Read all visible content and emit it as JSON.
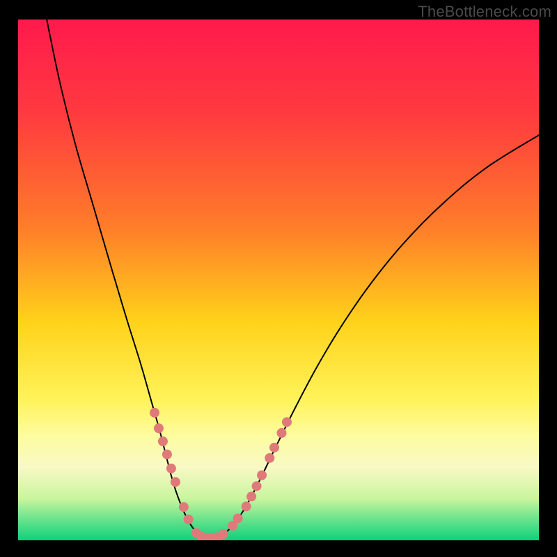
{
  "watermark": "TheBottleneck.com",
  "chart_data": {
    "type": "line",
    "title": "",
    "xlabel": "",
    "ylabel": "",
    "xlim": [
      0,
      100
    ],
    "ylim": [
      0,
      100
    ],
    "background": {
      "type": "vertical-gradient",
      "stops": [
        {
          "offset": 0.0,
          "color": "#ff1a4c"
        },
        {
          "offset": 0.18,
          "color": "#ff3a3f"
        },
        {
          "offset": 0.4,
          "color": "#ff7d2a"
        },
        {
          "offset": 0.58,
          "color": "#ffd21a"
        },
        {
          "offset": 0.73,
          "color": "#fff35a"
        },
        {
          "offset": 0.8,
          "color": "#fdfca0"
        },
        {
          "offset": 0.86,
          "color": "#f8f9c4"
        },
        {
          "offset": 0.92,
          "color": "#c9f59e"
        },
        {
          "offset": 0.965,
          "color": "#5de08a"
        },
        {
          "offset": 1.0,
          "color": "#10d07a"
        }
      ]
    },
    "series": [
      {
        "name": "left-curve",
        "stroke": "#000000",
        "points": [
          {
            "x": 5.5,
            "y": 100
          },
          {
            "x": 8.0,
            "y": 88
          },
          {
            "x": 11.0,
            "y": 76
          },
          {
            "x": 14.5,
            "y": 64
          },
          {
            "x": 18.0,
            "y": 52
          },
          {
            "x": 21.0,
            "y": 42
          },
          {
            "x": 23.5,
            "y": 34
          },
          {
            "x": 25.5,
            "y": 27
          },
          {
            "x": 27.2,
            "y": 21
          },
          {
            "x": 28.6,
            "y": 15.5
          },
          {
            "x": 29.8,
            "y": 11
          },
          {
            "x": 31.0,
            "y": 7.5
          },
          {
            "x": 32.2,
            "y": 4.7
          },
          {
            "x": 33.4,
            "y": 2.6
          },
          {
            "x": 34.7,
            "y": 1.2
          },
          {
            "x": 36.0,
            "y": 0.6
          },
          {
            "x": 37.3,
            "y": 0.5
          }
        ]
      },
      {
        "name": "right-curve",
        "stroke": "#000000",
        "points": [
          {
            "x": 37.3,
            "y": 0.5
          },
          {
            "x": 38.6,
            "y": 0.7
          },
          {
            "x": 40.0,
            "y": 1.6
          },
          {
            "x": 41.5,
            "y": 3.2
          },
          {
            "x": 43.2,
            "y": 5.6
          },
          {
            "x": 45.0,
            "y": 8.8
          },
          {
            "x": 47.2,
            "y": 13.2
          },
          {
            "x": 50.0,
            "y": 19.0
          },
          {
            "x": 53.5,
            "y": 26.0
          },
          {
            "x": 57.5,
            "y": 33.5
          },
          {
            "x": 62.0,
            "y": 41.0
          },
          {
            "x": 67.5,
            "y": 49.0
          },
          {
            "x": 74.0,
            "y": 57.0
          },
          {
            "x": 81.5,
            "y": 64.6
          },
          {
            "x": 90.0,
            "y": 71.6
          },
          {
            "x": 100.0,
            "y": 77.8
          }
        ]
      }
    ],
    "markers": {
      "color": "#e07a7a",
      "radius": 7,
      "points": [
        {
          "x": 26.2,
          "y": 24.5
        },
        {
          "x": 27.0,
          "y": 21.5
        },
        {
          "x": 27.8,
          "y": 19.0
        },
        {
          "x": 28.6,
          "y": 16.5
        },
        {
          "x": 29.4,
          "y": 13.8
        },
        {
          "x": 30.2,
          "y": 11.2
        },
        {
          "x": 31.8,
          "y": 6.4
        },
        {
          "x": 32.7,
          "y": 4.0
        },
        {
          "x": 34.2,
          "y": 1.4
        },
        {
          "x": 35.2,
          "y": 0.7
        },
        {
          "x": 36.2,
          "y": 0.5
        },
        {
          "x": 37.2,
          "y": 0.5
        },
        {
          "x": 38.3,
          "y": 0.6
        },
        {
          "x": 39.4,
          "y": 1.2
        },
        {
          "x": 41.2,
          "y": 2.8
        },
        {
          "x": 42.2,
          "y": 4.2
        },
        {
          "x": 43.8,
          "y": 6.5
        },
        {
          "x": 44.8,
          "y": 8.4
        },
        {
          "x": 45.8,
          "y": 10.4
        },
        {
          "x": 46.8,
          "y": 12.5
        },
        {
          "x": 48.3,
          "y": 15.8
        },
        {
          "x": 49.2,
          "y": 17.8
        },
        {
          "x": 50.6,
          "y": 20.6
        },
        {
          "x": 51.6,
          "y": 22.7
        }
      ]
    }
  }
}
